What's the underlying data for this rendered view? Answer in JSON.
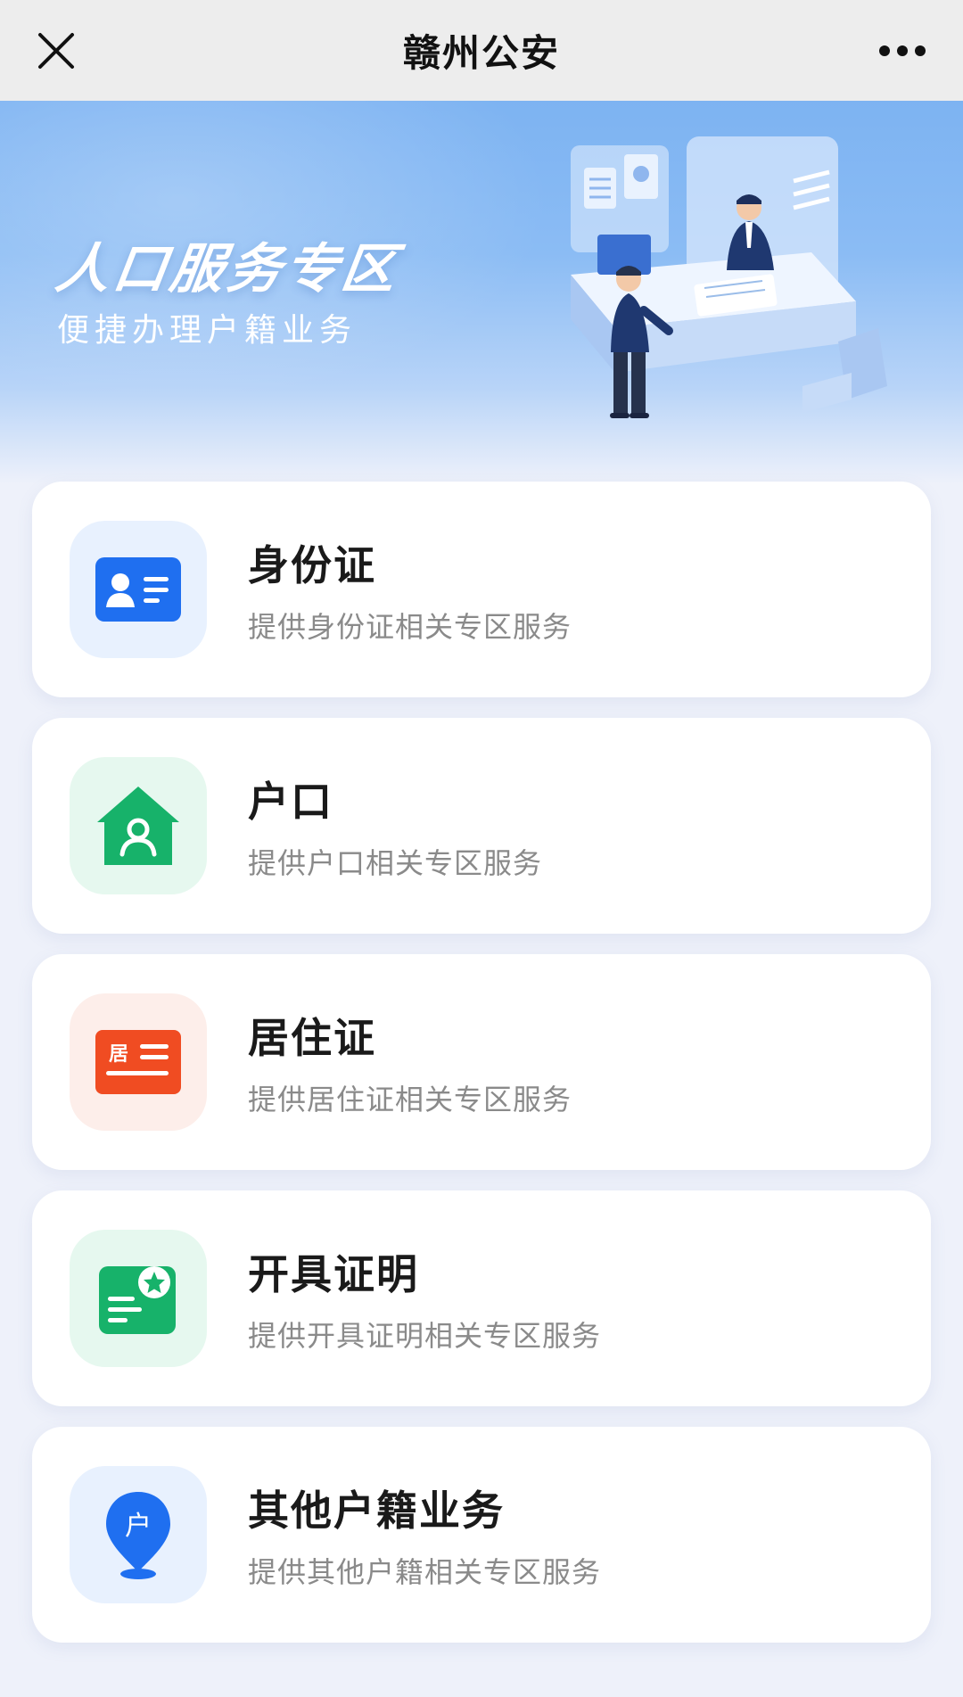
{
  "navbar": {
    "title": "赣州公安",
    "close_icon": "close-icon",
    "more_icon": "more-icon"
  },
  "banner": {
    "title": "人口服务专区",
    "subtitle": "便捷办理户籍业务"
  },
  "services": [
    {
      "title": "身份证",
      "description": "提供身份证相关专区服务",
      "icon": "id-card-icon",
      "icon_color": "#1f6ff0",
      "icon_bg": "#e8f1fe"
    },
    {
      "title": "户口",
      "description": "提供户口相关专区服务",
      "icon": "household-house-icon",
      "icon_color": "#17b26a",
      "icon_bg": "#e6f8ef"
    },
    {
      "title": "居住证",
      "description": "提供居住证相关专区服务",
      "icon": "residence-permit-icon",
      "icon_label": "居",
      "icon_color": "#f04c22",
      "icon_bg": "#fdeeea"
    },
    {
      "title": "开具证明",
      "description": "提供开具证明相关专区服务",
      "icon": "certificate-icon",
      "icon_color": "#17b26a",
      "icon_bg": "#e6f8ef"
    },
    {
      "title": "其他户籍业务",
      "description": "提供其他户籍相关专区服务",
      "icon": "location-pin-icon",
      "icon_label": "户",
      "icon_color": "#1f6ff0",
      "icon_bg": "#e8f1fe"
    }
  ]
}
